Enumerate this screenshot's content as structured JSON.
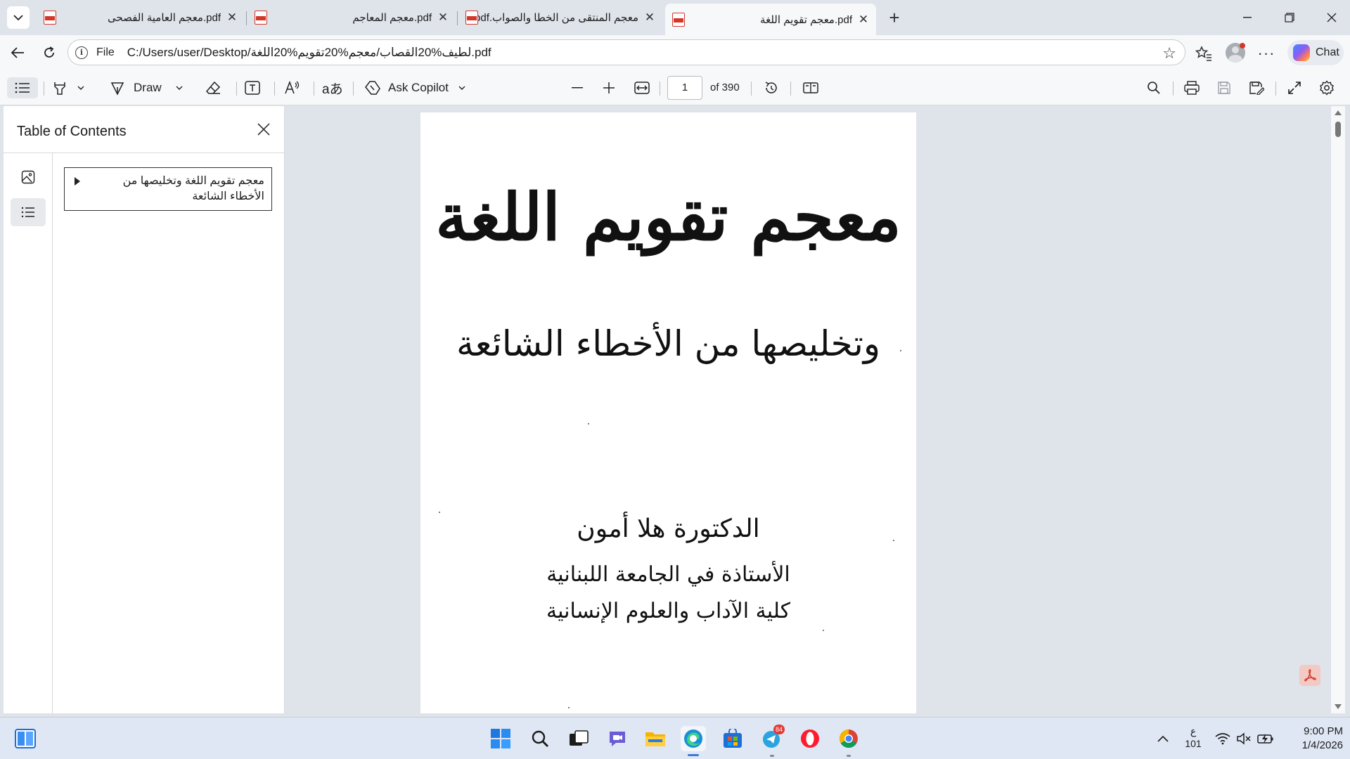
{
  "tabs": [
    {
      "title": "pdf.معجم العامية الفصحى",
      "active": false
    },
    {
      "title": "pdf.معجم المعاجم",
      "active": false
    },
    {
      "title": "معجم المنتقى من الخطا والصواب.pdf",
      "active": false
    },
    {
      "title": "pdf.معجم تقويم اللغة",
      "active": true
    }
  ],
  "address": {
    "scheme_label": "File",
    "url": "C:/Users/user/Desktop/لطيف%20القصاب/معجم%20تقويم%20اللغة.pdf"
  },
  "chat_label": "Chat",
  "toolbar": {
    "draw_label": "Draw",
    "copilot_label": "Ask Copilot",
    "page_number": "1",
    "page_total": "of 390"
  },
  "sidebar": {
    "title": "Table of Contents",
    "toc_items": [
      {
        "label": "معجم تقويم اللغة وتخليصها من الأخطاء الشائعة"
      }
    ]
  },
  "document": {
    "title": "معجم تقويم اللغة",
    "subtitle": "وتخليصها من الأخطاء الشائعة",
    "author": "الدكتورة هلا أمون",
    "affiliation_1": "الأستاذة في الجامعة اللبنانية",
    "affiliation_2": "كلية الآداب والعلوم الإنسانية"
  },
  "taskbar": {
    "telegram_badge": "84",
    "input_lang_top": "ع",
    "input_lang_bottom": "101",
    "time": "9:00 PM",
    "date": "1/4/2026"
  },
  "colors": {
    "accent": "#3a7bd5",
    "pdf_red": "#d3372a",
    "chrome_bg": "#dfe3ea"
  }
}
